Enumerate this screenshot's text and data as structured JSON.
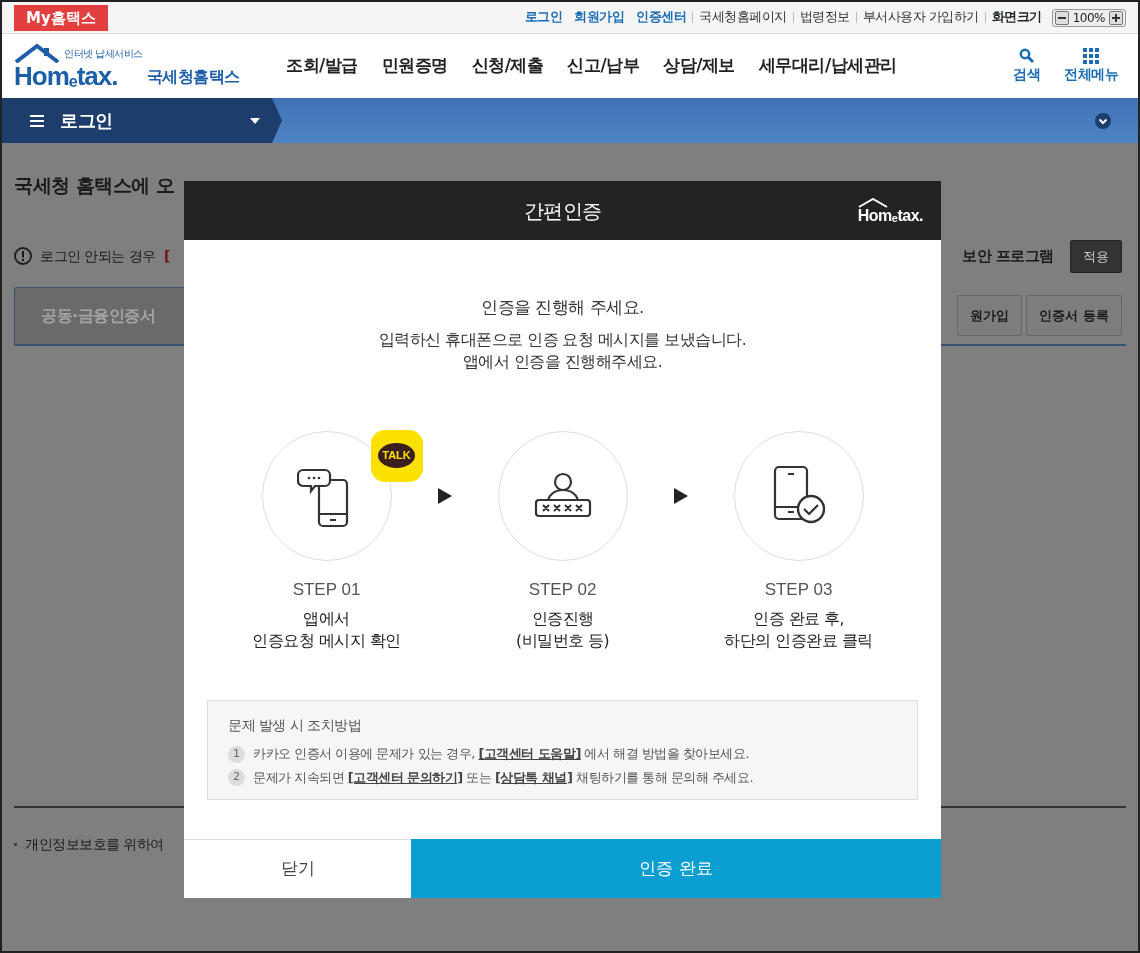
{
  "top_bar": {
    "my_button": "My홈택스",
    "links": [
      {
        "label": "로그인",
        "kind": "primary"
      },
      {
        "label": "회원가입",
        "kind": "primary"
      },
      {
        "label": "인증센터",
        "kind": "primary"
      },
      {
        "label": "국세청홈페이지",
        "kind": "plain"
      },
      {
        "label": "법령정보",
        "kind": "plain"
      },
      {
        "label": "부서사용자 가입하기",
        "kind": "plain"
      }
    ],
    "zoom": {
      "label": "화면크기",
      "value": "100%"
    }
  },
  "header": {
    "logo": {
      "tagline": "인터넷 납세서비스",
      "wordmark": "Hom$_{e}$tax.",
      "name": "국세청홈택스"
    },
    "menu": [
      "조회/발급",
      "민원증명",
      "신청/제출",
      "신고/납부",
      "상담/제보",
      "세무대리/납세관리"
    ],
    "tools": [
      {
        "label": "검색",
        "kind": "search"
      },
      {
        "label": "전체메뉴",
        "kind": "grid"
      }
    ]
  },
  "nav_bar": {
    "menu_label": "로그인"
  },
  "page": {
    "welcome": "국세청 홈택스에 오",
    "notice": "로그인 안되는 경우",
    "notice_link": "[",
    "security_label": "보안 프로그램",
    "apply_button": "적용",
    "tabs": [
      {
        "label": "공동·금융인증서",
        "selected": true
      }
    ],
    "buttons": [
      "원가입",
      "인증서 등록"
    ],
    "footnote": "개인정보보호를 위하여"
  },
  "modal": {
    "title": "간편인증",
    "logo": "Hom$_{e}$tax.",
    "intro": "인증을 진행해 주세요.",
    "message_lines": [
      "입력하신 휴대폰으로 인증 요청 메시지를 보냈습니다.",
      "앱에서 인증을 진행해주세요."
    ],
    "steps": [
      {
        "kind": "message",
        "step": "STEP 01",
        "lines": [
          "앱에서",
          "인증요청 메시지 확인"
        ],
        "badge": "TALK"
      },
      {
        "kind": "password",
        "step": "STEP 02",
        "lines": [
          "인증진행",
          "(비밀번호 등)"
        ]
      },
      {
        "kind": "check",
        "step": "STEP 03",
        "lines": [
          "인증 완료 후,",
          "하단의 인증완료 클릭"
        ]
      }
    ],
    "help": {
      "title": "문제 발생 시 조치방법",
      "items": [
        {
          "number": "1",
          "parts": [
            {
              "kind": "text",
              "text": "카카오 인증서 이용에 문제가 있는 경우, "
            },
            {
              "kind": "link",
              "text": "[고객센터 도움말]"
            },
            {
              "kind": "text",
              "text": " 에서 해결 방법을 찾아보세요."
            }
          ]
        },
        {
          "number": "2",
          "parts": [
            {
              "kind": "text",
              "text": "문제가 지속되면 "
            },
            {
              "kind": "link",
              "text": "[고객센터 문의하기]"
            },
            {
              "kind": "text",
              "text": " 또는 "
            },
            {
              "kind": "link",
              "text": "[상담톡 채널]"
            },
            {
              "kind": "text",
              "text": " 채팅하기를 통해 문의해 주세요."
            }
          ]
        }
      ]
    },
    "buttons": [
      {
        "label": "닫기",
        "kind": "secondary"
      },
      {
        "label": "인증 완료",
        "kind": "primary"
      }
    ]
  }
}
